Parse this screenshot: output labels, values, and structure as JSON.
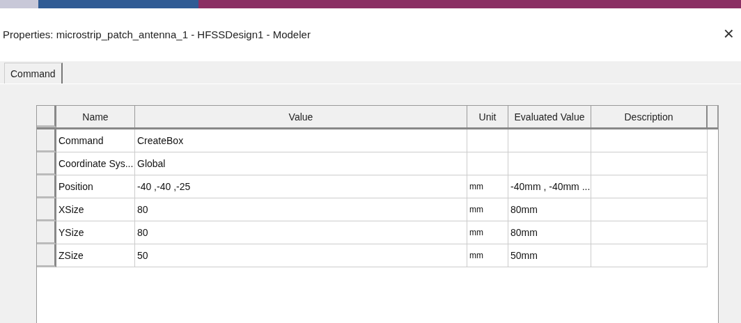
{
  "window": {
    "title": "Properties: microstrip_patch_antenna_1 - HFSSDesign1 - Modeler",
    "close": "×"
  },
  "tabs": [
    {
      "label": "Command",
      "selected": true
    }
  ],
  "table": {
    "columns": [
      "Name",
      "Value",
      "Unit",
      "Evaluated Value",
      "Description"
    ],
    "rows": [
      {
        "name": "Command",
        "value": "CreateBox"
      },
      {
        "name": "Coordinate Sys...",
        "value": "Global"
      },
      {
        "name": "Position",
        "value": "-40 ,-40 ,-25",
        "unit": "mm",
        "evaluated": "-40mm , -40mm ..."
      },
      {
        "name": "XSize",
        "value": "80",
        "unit": "mm",
        "evaluated": "80mm"
      },
      {
        "name": "YSize",
        "value": "80",
        "unit": "mm",
        "evaluated": "80mm"
      },
      {
        "name": "ZSize",
        "value": "50",
        "unit": "mm",
        "evaluated": "50mm"
      }
    ]
  }
}
